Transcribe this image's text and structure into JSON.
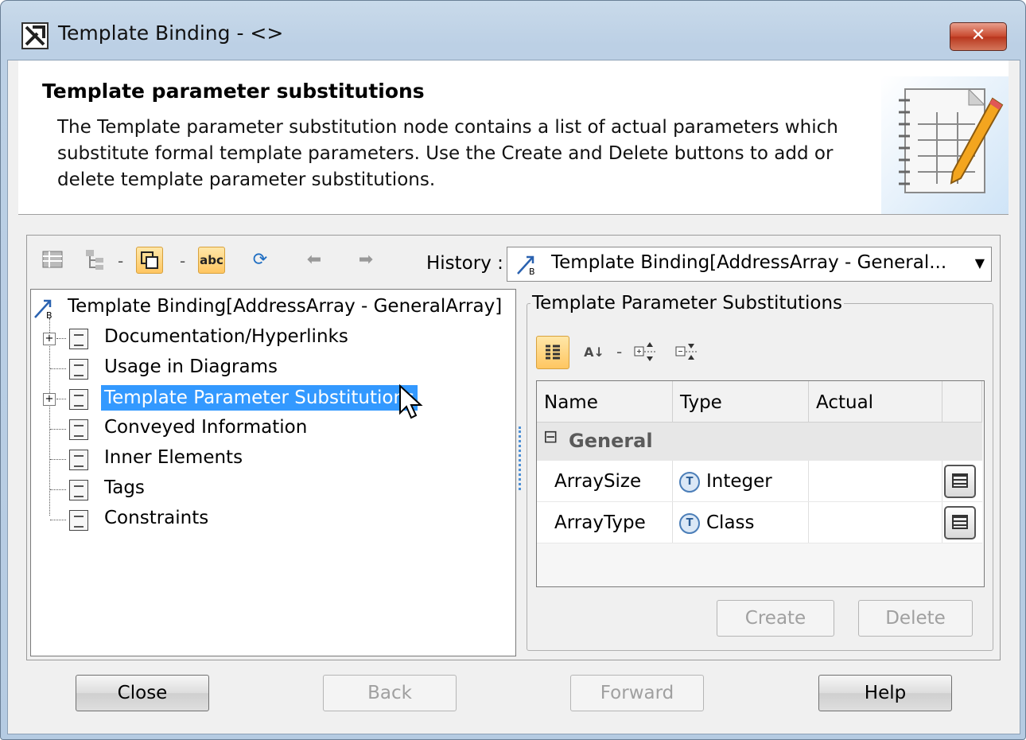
{
  "window": {
    "title": "Template Binding - <>",
    "close_symbol": "✕"
  },
  "header": {
    "title": "Template parameter substitutions",
    "description": "The Template parameter substitution node contains a list of actual parameters which substitute formal template parameters. Use the Create and Delete buttons to add or delete template parameter substitutions."
  },
  "toolbar": {
    "history_label": "History :",
    "history_value": "Template Binding[AddressArray - General...",
    "icons": [
      "grid-icon",
      "tree-icon",
      "copy-icon",
      "abc-icon",
      "refresh-icon",
      "back-arrow-icon",
      "forward-arrow-icon"
    ]
  },
  "tree": {
    "root": "Template Binding[AddressArray - GeneralArray]",
    "items": [
      {
        "label": "Documentation/Hyperlinks",
        "expandable": true,
        "selected": false
      },
      {
        "label": "Usage in Diagrams",
        "expandable": false,
        "selected": false
      },
      {
        "label": "Template Parameter Substitutions",
        "expandable": true,
        "selected": true
      },
      {
        "label": "Conveyed Information",
        "expandable": false,
        "selected": false
      },
      {
        "label": "Inner Elements",
        "expandable": false,
        "selected": false
      },
      {
        "label": "Tags",
        "expandable": false,
        "selected": false
      },
      {
        "label": "Constraints",
        "expandable": false,
        "selected": false
      }
    ]
  },
  "panel": {
    "title": "Template Parameter Substitutions",
    "columns": [
      "Name",
      "Type",
      "Actual"
    ],
    "category": "General",
    "category_toggle": "⊟",
    "rows": [
      {
        "name": "ArraySize",
        "type": "Integer",
        "type_icon": "T",
        "actual": ""
      },
      {
        "name": "ArrayType",
        "type": "Class",
        "type_icon": "T",
        "actual": ""
      }
    ],
    "create_label": "Create",
    "delete_label": "Delete"
  },
  "footer": {
    "close": "Close",
    "back": "Back",
    "forward": "Forward",
    "help": "Help"
  },
  "colors": {
    "selection": "#3399ff",
    "titlebar": "#bcd0e5",
    "close_button": "#c8482d"
  }
}
